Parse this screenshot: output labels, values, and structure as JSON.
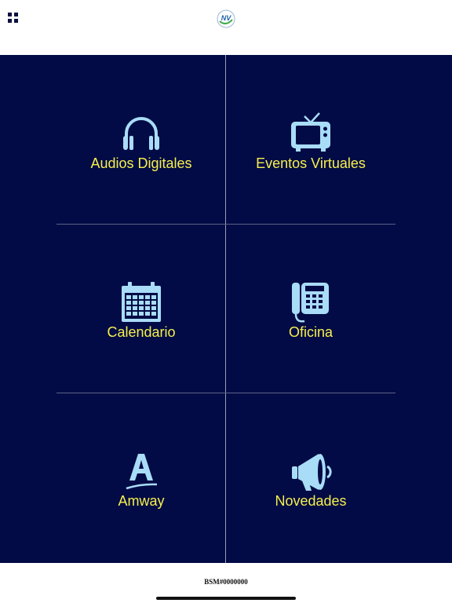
{
  "header": {
    "menu_icon": "grid-menu-icon",
    "logo_icon": "nv-logo-icon",
    "logo_text": "NV"
  },
  "tiles": [
    {
      "label": "Audios Digitales",
      "icon": "headphones-icon"
    },
    {
      "label": "Eventos Virtuales",
      "icon": "tv-icon"
    },
    {
      "label": "Calendario",
      "icon": "calendar-icon"
    },
    {
      "label": "Oficina",
      "icon": "office-phone-icon"
    },
    {
      "label": "Amway",
      "icon": "amway-icon"
    },
    {
      "label": "Novedades",
      "icon": "megaphone-icon"
    }
  ],
  "footer": {
    "code": "BSM#0000000"
  },
  "colors": {
    "background": "#020b45",
    "label": "#f6ef4e",
    "icon": "#a9dcf7"
  }
}
